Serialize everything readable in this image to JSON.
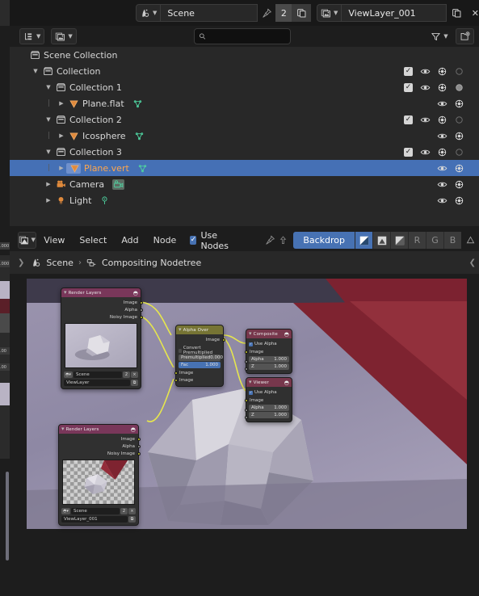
{
  "topbar": {
    "scene": {
      "icon": "scene-icon",
      "name": "Scene",
      "pin_icon": "pin-icon",
      "count": "2",
      "dup_icon": "duplicate-icon",
      "close_icon": "x-icon"
    },
    "viewlayer": {
      "icon": "viewlayer-icon",
      "name": "ViewLayer_001",
      "dup_icon": "duplicate-icon",
      "close_icon": "x-icon"
    }
  },
  "outliner": {
    "header": {
      "display_mode_icon": "outliner-display-mode-icon",
      "filter_id_icon": "id-type-filter-icon",
      "search_placeholder": "",
      "search_value": "",
      "search_icon": "search-icon",
      "filter_icon": "funnel-filter-icon",
      "new_collection_icon": "new-collection-icon"
    },
    "rows": [
      {
        "label": "Scene Collection",
        "icon": "collection-icon",
        "depth": 0,
        "disclosure": "",
        "selected": false,
        "restrict": []
      },
      {
        "label": "Collection",
        "icon": "collection-icon",
        "depth": 1,
        "disclosure": "down",
        "selected": false,
        "restrict": [
          "check-on",
          "eye-icon",
          "camera-icon",
          "holdout-off-icon"
        ]
      },
      {
        "label": "Collection 1",
        "icon": "collection-icon",
        "depth": 2,
        "disclosure": "down",
        "selected": false,
        "restrict": [
          "check-on",
          "eye-icon",
          "camera-icon",
          "holdout-on-icon"
        ]
      },
      {
        "label": "Plane.flat",
        "icon": "mesh-icon",
        "depth": 3,
        "disclosure": "right",
        "selected": false,
        "restrict": [
          "eye-icon",
          "camera-icon"
        ],
        "data_icon": "mesh-data-icon"
      },
      {
        "label": "Collection 2",
        "icon": "collection-icon",
        "depth": 2,
        "disclosure": "down",
        "selected": false,
        "restrict": [
          "check-on",
          "eye-icon",
          "camera-icon",
          "holdout-off-icon"
        ]
      },
      {
        "label": "Icosphere",
        "icon": "mesh-icon",
        "depth": 3,
        "disclosure": "right",
        "selected": false,
        "restrict": [
          "eye-icon",
          "camera-icon"
        ],
        "data_icon": "mesh-data-icon"
      },
      {
        "label": "Collection 3",
        "icon": "collection-icon",
        "depth": 2,
        "disclosure": "down",
        "selected": false,
        "restrict": [
          "check-on",
          "eye-icon",
          "camera-icon",
          "holdout-off-icon"
        ]
      },
      {
        "label": "Plane.vert",
        "icon": "mesh-icon",
        "depth": 3,
        "disclosure": "right",
        "selected": true,
        "restrict": [
          "eye-icon",
          "camera-icon"
        ],
        "data_icon": "mesh-data-icon"
      },
      {
        "label": "Camera",
        "icon": "camera-object-icon",
        "depth": 2,
        "disclosure": "right",
        "selected": false,
        "restrict": [
          "eye-icon",
          "camera-icon"
        ],
        "data_icon": "camera-data-icon"
      },
      {
        "label": "Light",
        "icon": "light-object-icon",
        "depth": 2,
        "disclosure": "right",
        "selected": false,
        "restrict": [
          "eye-icon",
          "camera-icon"
        ],
        "data_icon": "light-data-icon"
      }
    ]
  },
  "compositor": {
    "header": {
      "editor_type_icon": "compositor-editor-icon",
      "menus": [
        "View",
        "Select",
        "Add",
        "Node"
      ],
      "use_nodes_label": "Use Nodes",
      "use_nodes_checked": true,
      "pin_icon": "pin-icon",
      "parent_icon": "go-to-parent-icon",
      "backdrop_label": "Backdrop",
      "channel_buttons": [
        {
          "label": "",
          "icon": "color-and-alpha-icon",
          "active": true
        },
        {
          "label": "",
          "icon": "color-icon",
          "active": false
        },
        {
          "label": "",
          "icon": "alpha-icon",
          "active": false
        },
        {
          "label": "R",
          "icon": "red-channel-icon",
          "active": false
        },
        {
          "label": "G",
          "icon": "green-channel-icon",
          "active": false
        },
        {
          "label": "B",
          "icon": "blue-channel-icon",
          "active": false
        }
      ]
    },
    "breadcrumb": {
      "scene_icon": "scene-icon",
      "scene": "Scene",
      "separator": "›",
      "tree_icon": "nodetree-icon",
      "tree": "Compositing Nodetree"
    },
    "nodes": [
      {
        "id": "render-layers-1",
        "title": "Render Layers",
        "header_icon": "render-layers-icon",
        "outputs": [
          {
            "label": "Image",
            "type": "image"
          },
          {
            "label": "Alpha",
            "type": "value"
          },
          {
            "label": "Noisy Image",
            "type": "image"
          }
        ],
        "scene_field": "Scene",
        "scene_count": "2",
        "scene_close": "×",
        "viewlayer_field": "ViewLayer"
      },
      {
        "id": "render-layers-2",
        "title": "Render Layers",
        "header_icon": "render-layers-icon",
        "outputs": [
          {
            "label": "Image",
            "type": "image"
          },
          {
            "label": "Alpha",
            "type": "value"
          },
          {
            "label": "Noisy Image",
            "type": "image"
          }
        ],
        "scene_field": "Scene",
        "scene_count": "2",
        "scene_close": "×",
        "viewlayer_field": "ViewLayer_001"
      },
      {
        "id": "alpha-over",
        "title": "Alpha Over",
        "outputs": [
          {
            "label": "Image",
            "type": "image"
          }
        ],
        "convert_premul_label": "Convert Premultiplied",
        "convert_premul_checked": false,
        "premul_label": "Premultiplied",
        "premul_value": "0.000",
        "fac_label": "Fac",
        "fac_value": "1.000",
        "inputs": [
          {
            "label": "Image",
            "type": "image"
          },
          {
            "label": "Image",
            "type": "image"
          }
        ]
      },
      {
        "id": "composite",
        "title": "Composite",
        "header_icon": "composite-icon",
        "use_alpha_label": "Use Alpha",
        "use_alpha_checked": true,
        "image_label": "Image",
        "alpha_label": "Alpha",
        "alpha_value": "1.000",
        "z_label": "Z",
        "z_value": "1.000"
      },
      {
        "id": "viewer",
        "title": "Viewer",
        "header_icon": "viewer-icon",
        "use_alpha_label": "Use Alpha",
        "use_alpha_checked": true,
        "image_label": "Image",
        "alpha_label": "Alpha",
        "alpha_value": "1.000",
        "z_label": "Z",
        "z_value": "1.000"
      }
    ]
  },
  "colors": {
    "accent_blue": "#4772b3",
    "selected_row": "#4570b5",
    "selected_text": "#ffa64d",
    "node_input_header": "#79375a",
    "node_converter_header": "#767434",
    "node_output_header": "#77374c",
    "socket_image": "#c7c729",
    "socket_value": "#9a9a9a",
    "link": "#e6e64d",
    "panel_bg": "#282828",
    "editor_bg": "#1d1d1d"
  }
}
